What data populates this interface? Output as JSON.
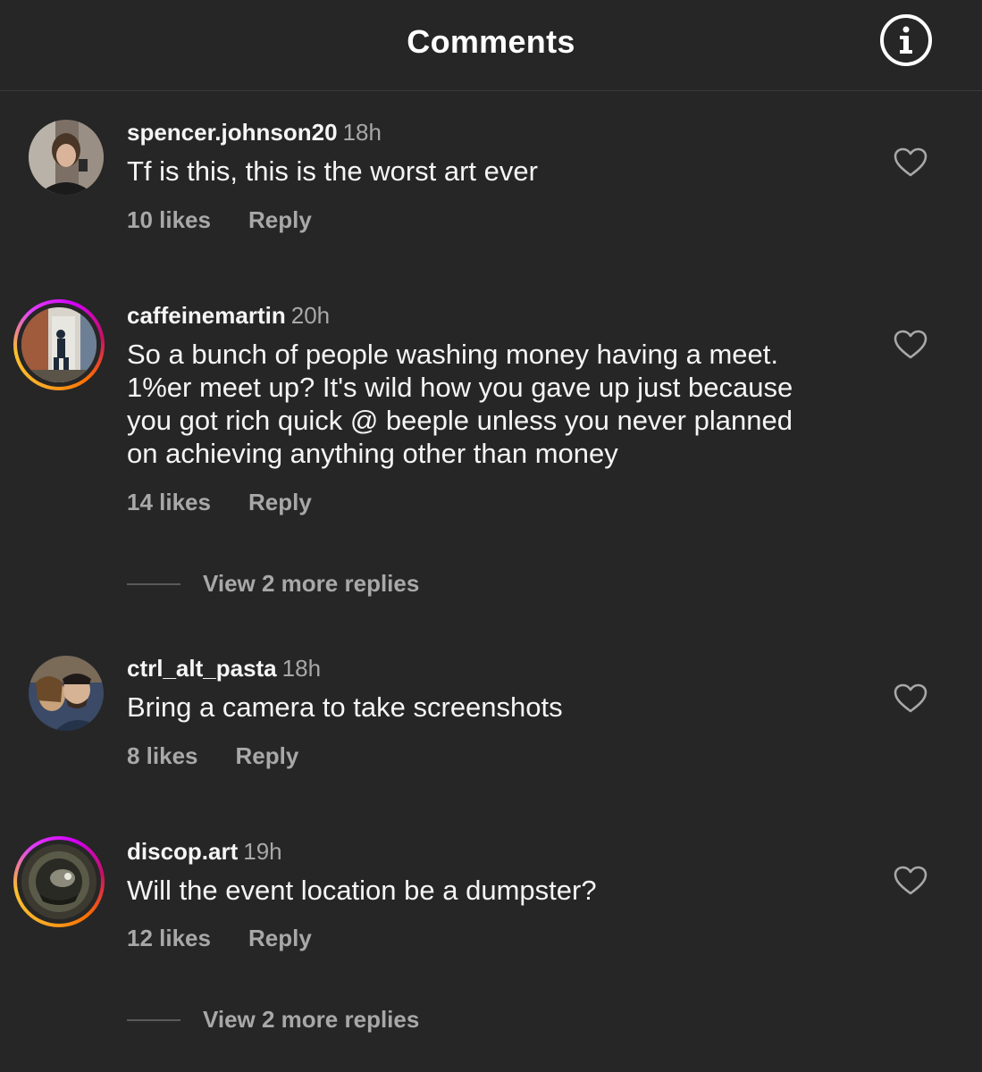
{
  "header": {
    "title": "Comments",
    "info_icon": "info-circle-icon"
  },
  "comments": [
    {
      "username": "spencer.johnson20",
      "time": "18h",
      "lines": [
        "Tf is this, this is the worst art ever"
      ],
      "likes": "10 likes",
      "reply": "Reply",
      "has_story_ring": false
    },
    {
      "username": "caffeinemartin",
      "time": "20h",
      "lines": [
        "So a bunch of people washing money having a meet.",
        "1%er meet up? It's wild how you gave up just because",
        "you got rich quick @ beeple unless you never planned",
        "on achieving anything other than money"
      ],
      "likes": "14 likes",
      "reply": "Reply",
      "has_story_ring": true,
      "view_replies": "View 2 more replies"
    },
    {
      "username": "ctrl_alt_pasta",
      "time": "18h",
      "lines": [
        "Bring a camera to take screenshots"
      ],
      "likes": "8 likes",
      "reply": "Reply",
      "has_story_ring": false
    },
    {
      "username": "discop.art",
      "time": "19h",
      "lines": [
        "Will the event location be a dumpster?"
      ],
      "likes": "12 likes",
      "reply": "Reply",
      "has_story_ring": true,
      "view_replies": "View 2 more replies"
    }
  ],
  "colors": {
    "background": "#262626",
    "primary_text": "#f5f5f5",
    "secondary_text": "#a8a8a8"
  }
}
